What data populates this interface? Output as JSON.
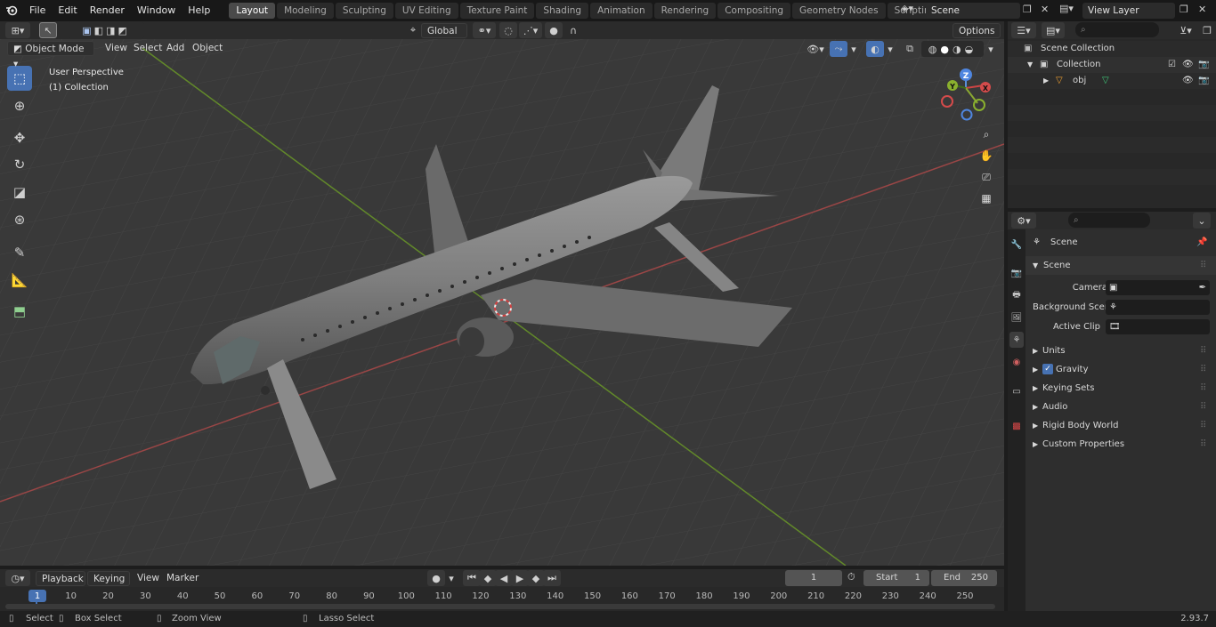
{
  "menu": [
    "File",
    "Edit",
    "Render",
    "Window",
    "Help"
  ],
  "workspaces": [
    {
      "label": "Layout",
      "active": true
    },
    {
      "label": "Modeling",
      "active": false
    },
    {
      "label": "Sculpting",
      "active": false
    },
    {
      "label": "UV Editing",
      "active": false
    },
    {
      "label": "Texture Paint",
      "active": false
    },
    {
      "label": "Shading",
      "active": false
    },
    {
      "label": "Animation",
      "active": false
    },
    {
      "label": "Rendering",
      "active": false
    },
    {
      "label": "Compositing",
      "active": false
    },
    {
      "label": "Geometry Nodes",
      "active": false
    },
    {
      "label": "Scripting",
      "active": false
    }
  ],
  "top_right": {
    "scene": "Scene",
    "view_layer": "View Layer"
  },
  "viewport_header": {
    "mode": "Object Mode",
    "menus": [
      "View",
      "Select",
      "Add",
      "Object"
    ],
    "transform_orientation": "Global",
    "options": "Options"
  },
  "viewport_overlay": {
    "perspective": "User Perspective",
    "collection": "(1) Collection"
  },
  "gizmo": {
    "z": "Z",
    "y": "Y",
    "x": "X"
  },
  "outliner": {
    "scene_collection": "Scene Collection",
    "collection": "Collection",
    "object": "obj"
  },
  "properties": {
    "context": "Scene",
    "panel_title": "Scene",
    "camera_label": "Camera",
    "background_label": "Background Scene",
    "clip_label": "Active Clip",
    "sections": [
      "Units",
      "Gravity",
      "Keying Sets",
      "Audio",
      "Rigid Body World",
      "Custom Properties"
    ]
  },
  "timeline": {
    "menus": [
      "Playback",
      "Keying",
      "View",
      "Marker"
    ],
    "current_frame": "1",
    "start_label": "Start",
    "start": "1",
    "end_label": "End",
    "end": "250",
    "ruler": [
      "1",
      "10",
      "20",
      "30",
      "40",
      "50",
      "60",
      "70",
      "80",
      "90",
      "100",
      "110",
      "120",
      "130",
      "140",
      "150",
      "160",
      "170",
      "180",
      "190",
      "200",
      "210",
      "220",
      "230",
      "240",
      "250"
    ]
  },
  "status_bar": {
    "select": "Select",
    "box_select": "Box Select",
    "zoom_view": "Zoom View",
    "lasso_select": "Lasso Select",
    "version": "2.93.7"
  },
  "colors": {
    "accent": "#4772b3",
    "axis_x": "#b04a4a",
    "axis_y": "#6f9a2a",
    "viewport_bg": "#393939"
  }
}
